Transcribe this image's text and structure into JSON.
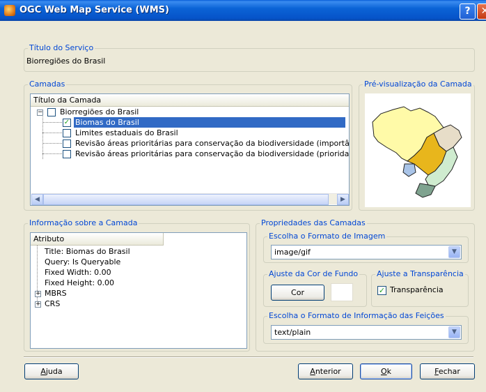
{
  "window": {
    "title": "OGC Web Map Service (WMS)",
    "help_glyph": "?",
    "close_glyph": "✕"
  },
  "service": {
    "legend": "Título do Serviço",
    "value": "Biorregiões do Brasil"
  },
  "layers": {
    "legend": "Camadas",
    "column_header": "Título da Camada",
    "root": {
      "label": "Biorregiões do Brasil",
      "checked": false
    },
    "children": [
      {
        "label": "Biomas do Brasil",
        "checked": true,
        "selected": true
      },
      {
        "label": "Limites estaduais do Brasil",
        "checked": false
      },
      {
        "label": "Revisão áreas prioritárias para conservação da biodiversidade (importância biológica)",
        "checked": false
      },
      {
        "label": "Revisão áreas prioritárias para conservação da biodiversidade (prioridade de ação)",
        "checked": false
      }
    ]
  },
  "preview": {
    "legend": "Pré-visualização da Camada"
  },
  "info": {
    "legend": "Informação sobre a Camada",
    "column_header": "Atributo",
    "items": [
      "Title: Biomas do Brasil",
      "Query: Is Queryable",
      "Fixed Width: 0.00",
      "Fixed Height: 0.00"
    ],
    "expandables": [
      "MBRS",
      "CRS"
    ]
  },
  "properties": {
    "legend": "Propriedades das Camadas",
    "image_format": {
      "legend": "Escolha o Formato de Imagem",
      "value": "image/gif"
    },
    "bg_color": {
      "legend": "Ajuste da Cor de Fundo",
      "button": "Cor",
      "swatch": "#ffffff"
    },
    "transparency": {
      "legend": "Ajuste a Transparência",
      "label": "Transparência",
      "checked": true
    },
    "feature_info": {
      "legend": "Escolha o Formato de Informação das Feições",
      "value": "text/plain"
    }
  },
  "footer": {
    "help": "Ajuda",
    "previous": "Anterior",
    "ok": "Ok",
    "close": "Fechar"
  },
  "colors": {
    "title_blue": "#0a5fd8",
    "group_label": "#0046d5",
    "selection": "#316ac5",
    "dialog_bg": "#ece9d8"
  }
}
